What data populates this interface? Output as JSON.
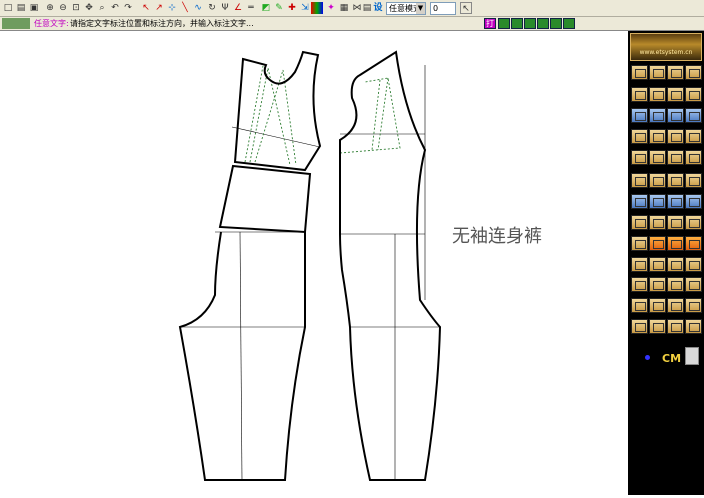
{
  "toolbar": {
    "mode_select_value": "任意模式",
    "value_input": "0"
  },
  "status": {
    "tool_name": "任意文字:",
    "hint": "请指定文字标注位置和标注方向，并输入标注文字..."
  },
  "side_panel": {
    "logo_text": "www.etsystem.cn",
    "unit_label": "CM"
  },
  "canvas": {
    "garment_label": "无袖连身裤"
  },
  "colors": {
    "pattern_line": "#000000",
    "dart_line": "#2e7d32",
    "panel_bg": "#000000"
  }
}
